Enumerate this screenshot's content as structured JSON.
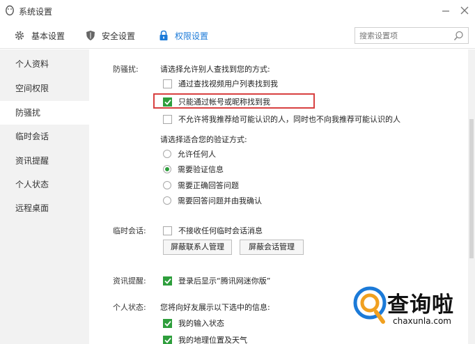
{
  "window": {
    "title": "系统设置"
  },
  "tabs": [
    {
      "label": "基本设置",
      "icon": "gear-icon"
    },
    {
      "label": "安全设置",
      "icon": "shield-icon"
    },
    {
      "label": "权限设置",
      "icon": "lock-icon",
      "active": true
    }
  ],
  "search": {
    "placeholder": "搜索设置项"
  },
  "sidebar": {
    "items": [
      {
        "label": "个人资料"
      },
      {
        "label": "空间权限"
      },
      {
        "label": "防骚扰",
        "active": true
      },
      {
        "label": "临时会话"
      },
      {
        "label": "资讯提醒"
      },
      {
        "label": "个人状态"
      },
      {
        "label": "远程桌面"
      }
    ]
  },
  "anti_harass": {
    "label": "防骚扰:",
    "find_prompt": "请选择允许别人查找到您的方式:",
    "find_options": [
      {
        "label": "通过查找视频用户列表找到我",
        "checked": false
      },
      {
        "label": "只能通过帐号或昵称找到我",
        "checked": true
      },
      {
        "label": "不允许将我推荐给可能认识的人，同时也不向我推荐可能认识的人",
        "checked": false
      }
    ],
    "verify_prompt": "请选择适合您的验证方式:",
    "verify_options": [
      {
        "label": "允许任何人",
        "selected": false
      },
      {
        "label": "需要验证信息",
        "selected": true
      },
      {
        "label": "需要正确回答问题",
        "selected": false
      },
      {
        "label": "需要回答问题并由我确认",
        "selected": false
      }
    ]
  },
  "temp_session": {
    "label": "临时会话:",
    "option": {
      "label": "不接收任何临时会话消息",
      "checked": false
    },
    "buttons": {
      "contacts": "屏蔽联系人管理",
      "sessions": "屏蔽会话管理"
    }
  },
  "news_reminder": {
    "label": "资讯提醒:",
    "option": {
      "label": "登录后显示“腾讯网迷你版”",
      "checked": true
    }
  },
  "personal_status": {
    "label": "个人状态:",
    "prompt": "您将向好友展示以下选中的信息:",
    "options": [
      {
        "label": "我的输入状态",
        "checked": true
      },
      {
        "label": "我的地理位置及天气",
        "checked": true
      }
    ]
  },
  "watermark": {
    "title": "查询啦",
    "subtitle": "chaxunla.com"
  },
  "colors": {
    "accent": "#1b7ad8",
    "check": "#2e9e3c",
    "highlight": "#d84040"
  }
}
